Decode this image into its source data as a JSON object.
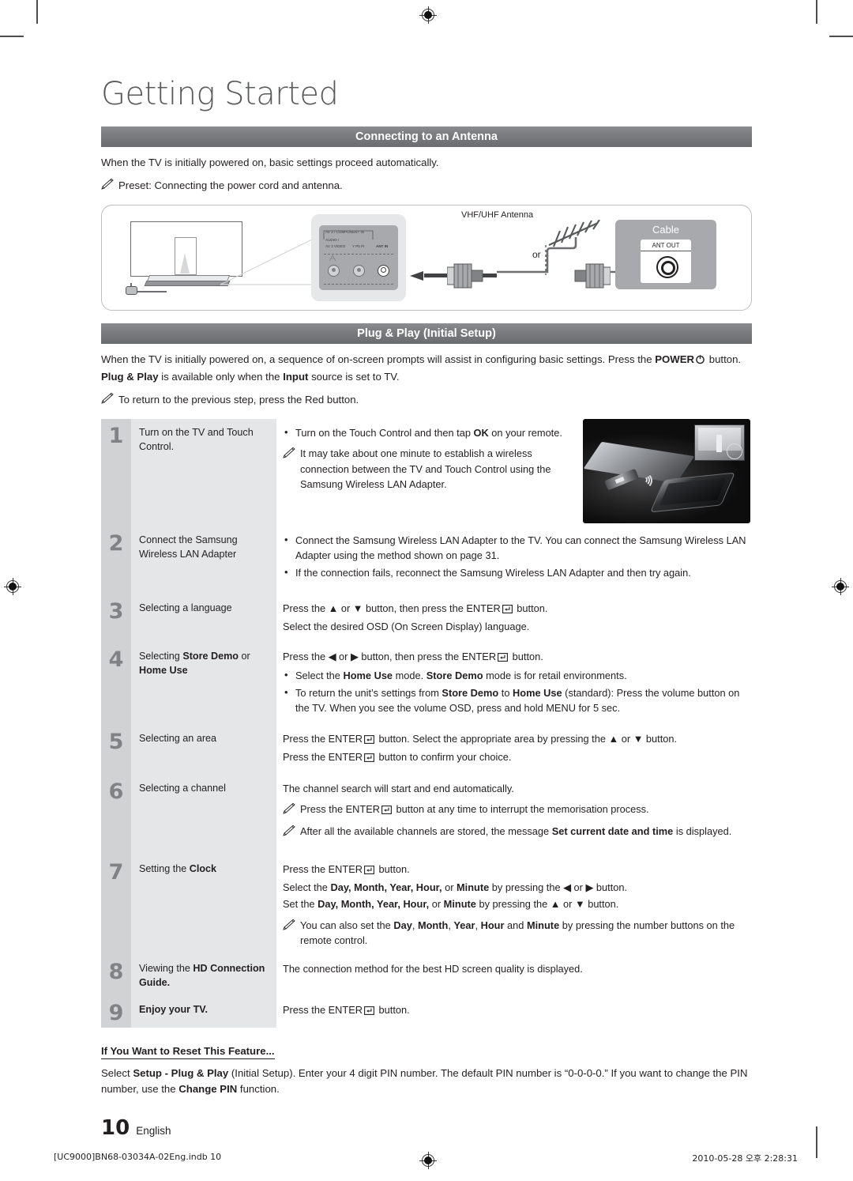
{
  "chapter": {
    "title": "Getting Started"
  },
  "section1": {
    "bar_title": "Connecting to an Antenna",
    "paragraph": "When the TV is initially powered on, basic settings proceed automatically.",
    "note": "Preset: Connecting the power cord and antenna.",
    "diagram": {
      "antenna_label": "VHF/UHF Antenna",
      "or_label": "or",
      "cable_box_title": "Cable",
      "ant_out_label": "ANT OUT",
      "panel": {
        "group_label": "AV 2 / COMPONENT IN",
        "audio_label": "AUDIO /",
        "av2video_label": "AV 2 VIDEO",
        "ypbpr_label": "Y Pb Pr",
        "antin_label": "ANT IN"
      }
    }
  },
  "section2": {
    "bar_title": "Plug & Play (Initial Setup)",
    "paragraph_parts": {
      "p1": "When the TV is initially powered on, a sequence of on-screen prompts will assist in configuring basic settings. Press the ",
      "power": "POWER",
      "p2": " button. ",
      "plugplay": "Plug & Play",
      "p3": " is available only when the ",
      "input": "Input",
      "p4": " source is set to TV."
    },
    "note": "To return to the previous step, press the Red button."
  },
  "steps": [
    {
      "num": "1",
      "title": "Turn on the TV and Touch Control.",
      "bullets": [
        {
          "pre": "Turn on the Touch Control and then tap ",
          "bold": "OK",
          "post": " on your remote."
        }
      ],
      "notes": [
        "It may take about one minute to establish a wireless connection between the TV and Touch Control using the Samsung Wireless LAN Adapter."
      ],
      "has_photo": true
    },
    {
      "num": "2",
      "title": "Connect the Samsung Wireless LAN Adapter",
      "bullets": [
        {
          "pre": "Connect the Samsung Wireless LAN Adapter to the TV. You can connect the Samsung Wireless LAN Adapter using the method shown on page 31.",
          "bold": "",
          "post": ""
        },
        {
          "pre": "If the connection fails, reconnect the Samsung Wireless LAN Adapter and then try again.",
          "bold": "",
          "post": ""
        }
      ],
      "notes": [],
      "has_photo": false
    },
    {
      "num": "3",
      "title_plain": "Selecting a language",
      "lines": [
        "Press the ▲ or ▼ button, then press the ENTER↵ button.",
        "Select the desired OSD (On Screen Display) language."
      ]
    },
    {
      "num": "4",
      "title_rich": {
        "pre": "Selecting ",
        "b1": "Store Demo",
        "mid": " or ",
        "b2": "Home Use"
      },
      "lines": [
        "Press the ◀ or ▶ button, then press the ENTER↵ button."
      ],
      "bullets": [
        "Select the Home Use mode. Store Demo mode is for retail environments.",
        "To return the unit's settings from Store Demo to Home Use (standard): Press the volume button on the TV. When you see the volume OSD, press and hold MENU for 5 sec."
      ]
    },
    {
      "num": "5",
      "title_plain": "Selecting an area",
      "lines": [
        "Press the ENTER↵ button. Select the appropriate area by pressing the ▲ or ▼ button.",
        "Press the ENTER↵ button to confirm your choice."
      ]
    },
    {
      "num": "6",
      "title_plain": "Selecting a channel",
      "lines": [
        "The channel search will start and end automatically."
      ],
      "notes": [
        "Press the ENTER↵ button at any time to interrupt the memorisation process.",
        "After all the available channels are stored, the message Set current date and time is displayed."
      ]
    },
    {
      "num": "7",
      "title_rich": {
        "pre": "Setting the ",
        "b1": "Clock",
        "mid": "",
        "b2": ""
      },
      "lines": [
        "Press the ENTER↵ button.",
        "Select the Day, Month, Year, Hour, or Minute by pressing the ◀ or ▶ button.",
        "Set the Day, Month, Year, Hour, or Minute by pressing the ▲ or ▼ button."
      ],
      "notes": [
        "You can also set the Day, Month, Year, Hour and Minute by pressing the number buttons on the remote control."
      ]
    },
    {
      "num": "8",
      "title_rich": {
        "pre": "Viewing the ",
        "b1": "HD Connection Guide.",
        "mid": "",
        "b2": ""
      },
      "lines": [
        "The connection method for the best HD screen quality is displayed."
      ]
    },
    {
      "num": "9",
      "title_bold": "Enjoy your TV.",
      "lines": [
        "Press the ENTER↵ button."
      ]
    }
  ],
  "reset": {
    "heading": "If You Want to Reset This Feature...",
    "body_parts": {
      "p1": "Select ",
      "b1": "Setup - Plug & Play",
      "p2": " (Initial Setup). Enter your 4 digit PIN number. The default PIN number is “0-0-0-0.” If you want to change the PIN number, use the ",
      "b2": "Change PIN",
      "p3": " function."
    }
  },
  "page_footer": {
    "page_number": "10",
    "language": "English",
    "file_info": "[UC9000]BN68-03034A-02Eng.indb   10",
    "timestamp": "2010-05-28   오후 2:28:31"
  }
}
